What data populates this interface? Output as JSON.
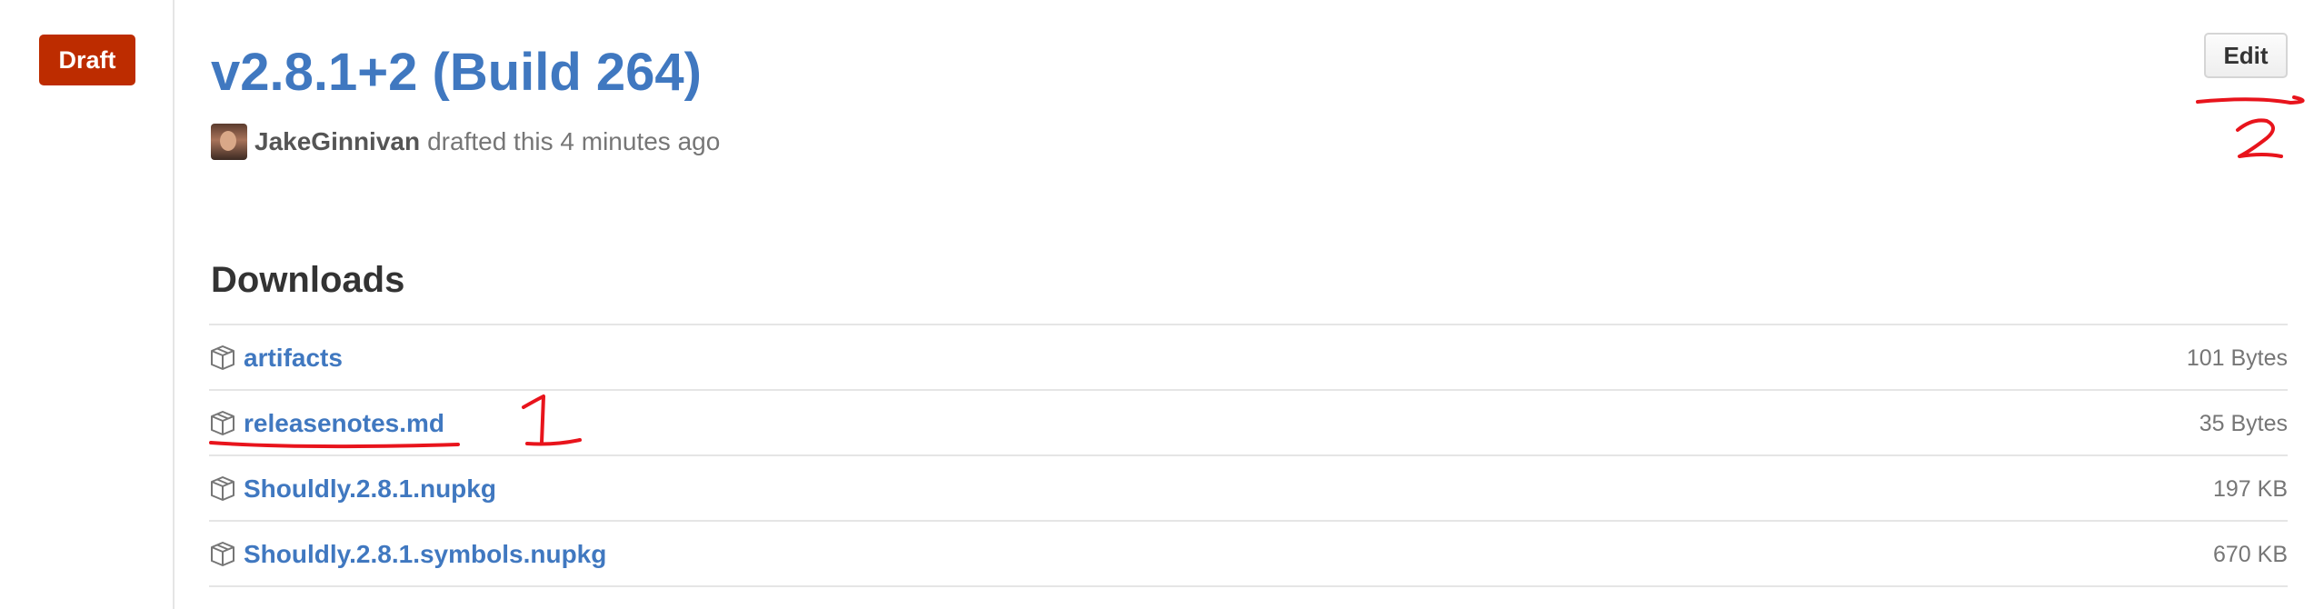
{
  "status_badge": "Draft",
  "release": {
    "title": "v2.8.1+2 (Build 264)",
    "author": "JakeGinnivan",
    "action_text": "drafted this 4 minutes ago"
  },
  "edit_button": "Edit",
  "downloads": {
    "heading": "Downloads",
    "items": [
      {
        "name": "artifacts",
        "size": "101 Bytes",
        "icon": "package-icon"
      },
      {
        "name": "releasenotes.md",
        "size": "35 Bytes",
        "icon": "package-icon"
      },
      {
        "name": "Shouldly.2.8.1.nupkg",
        "size": "197 KB",
        "icon": "package-icon"
      },
      {
        "name": "Shouldly.2.8.1.symbols.nupkg",
        "size": "670 KB",
        "icon": "package-icon"
      }
    ]
  },
  "annotations": {
    "color": "#e8141c",
    "marks": [
      "1",
      "2"
    ]
  },
  "colors": {
    "draft": "#bd2c00",
    "link": "#4078c0"
  }
}
